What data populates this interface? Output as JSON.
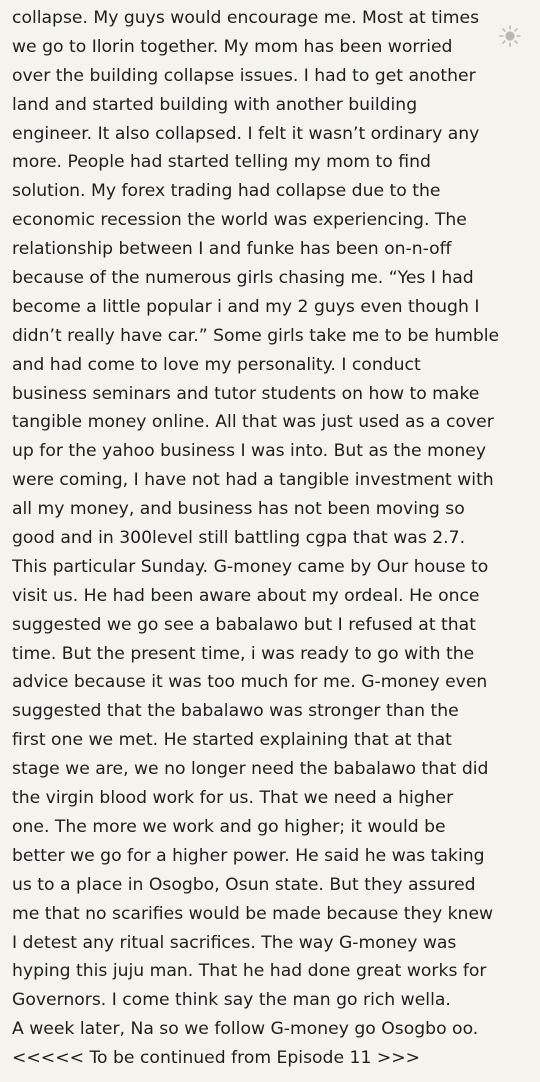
{
  "reader": {
    "brightness_icon": "sun-icon",
    "accent_color": "#b8b8b8",
    "lines": [
      "collapse. My guys would encourage me. Most at times",
      "we go to Ilorin together. My mom has been worried",
      "over the building collapse issues. I had to get another",
      "land and started building with another building",
      "engineer. It also collapsed. I felt it wasn’t ordinary any",
      "more. People had started telling my mom to find",
      "solution. My forex trading had collapse due to the",
      "economic recession the world was experiencing. The",
      "relationship between I and funke has been on-n-off",
      "because of the numerous girls chasing me. “Yes I had",
      "become a little popular i and my 2 guys even though I",
      "didn’t really have car.” Some girls take me to be humble",
      "and had come to love my personality. I conduct",
      "business seminars and tutor students on how to make",
      "tangible money online. All that was just used as a cover",
      "up for the yahoo business I was into. But as the money",
      "were coming, I have not had a tangible investment with",
      "all my money, and business has not been moving so",
      "good and in 300level still battling cgpa that was 2.7.",
      "This particular Sunday. G-money came by Our house to",
      "visit us. He had been aware about my ordeal. He once",
      "suggested we go see a babalawo but I refused at that",
      "time. But the present time, i was ready to go with the",
      "advice because it was too much for me. G-money even",
      "suggested that the babalawo was stronger than the",
      "first one we met. He started explaining that at that",
      "stage we are, we no longer need the babalawo that did",
      "the virgin blood work for us. That we need a higher",
      "one. The more we work and go higher; it would be",
      "better we go for a higher power. He said he was taking",
      "us to a place in Osogbo, Osun state. But they assured",
      "me that no scarifies would be made because they knew",
      "I detest any ritual sacrifices. The way G-money was",
      "hyping this juju man. That he had done great works for",
      "Governors. I come think say the man go rich wella.",
      "A week later, Na so we follow G-money go Osogbo oo.",
      "<<<<< To be continued from Episode 11 >>>"
    ]
  }
}
